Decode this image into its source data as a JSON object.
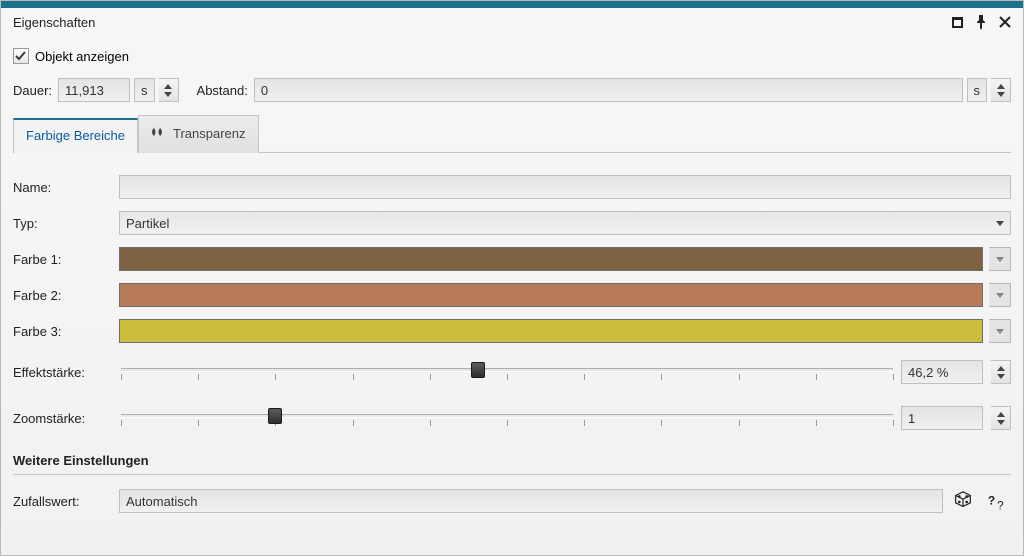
{
  "panel": {
    "title": "Eigenschaften"
  },
  "show_object": {
    "label": "Objekt anzeigen",
    "checked": true
  },
  "duration": {
    "label": "Dauer:",
    "value": "11,913",
    "unit": "s"
  },
  "spacing": {
    "label": "Abstand:",
    "value": "0",
    "unit": "s"
  },
  "tabs": {
    "colored": "Farbige Bereiche",
    "transparency": "Transparenz",
    "active": "colored"
  },
  "form": {
    "name": {
      "label": "Name:",
      "value": ""
    },
    "type": {
      "label": "Typ:",
      "value": "Partikel"
    },
    "color1": {
      "label": "Farbe 1:",
      "hex": "#7d6244"
    },
    "color2": {
      "label": "Farbe 2:",
      "hex": "#b77a57"
    },
    "color3": {
      "label": "Farbe 3:",
      "hex": "#cdbd3d"
    },
    "effect": {
      "label": "Effektstärke:",
      "value": "46,2 %",
      "pos": 46.2
    },
    "zoom": {
      "label": "Zoomstärke:",
      "value": "1",
      "pos": 20
    }
  },
  "more_settings": {
    "heading": "Weitere Einstellungen",
    "random": {
      "label": "Zufallswert:",
      "value": "Automatisch"
    }
  }
}
